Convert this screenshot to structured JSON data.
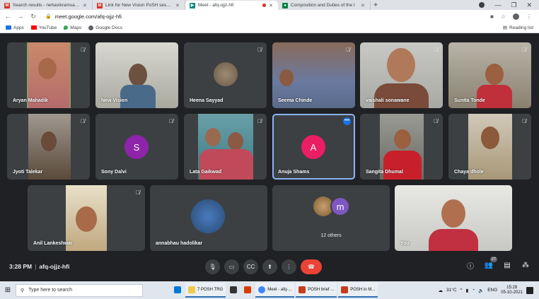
{
  "browser": {
    "tabs": [
      {
        "label": "Search results - nehavikramsathe",
        "favicon": "gmail-icon",
        "color": "#d93025",
        "active": false
      },
      {
        "label": "Link for New Vision PoSH session",
        "favicon": "gmail-icon",
        "color": "#d93025",
        "active": false
      },
      {
        "label": "Meet - afq-ojjz-hfi",
        "favicon": "meet-icon",
        "color": "#00897b",
        "active": true
      },
      {
        "label": "Composition and Duties of the I",
        "favicon": "site-icon",
        "color": "#0b8043",
        "active": false
      }
    ],
    "new_tab": "+",
    "url": "meet.google.com/afq-ojjz-hfi",
    "bookmarks": [
      {
        "label": "Apps",
        "icon": "apps-grid-icon",
        "color": "#1a73e8"
      },
      {
        "label": "YouTube",
        "icon": "youtube-icon",
        "color": "#ff0000"
      },
      {
        "label": "Maps",
        "icon": "maps-pin-icon",
        "color": "#34a853"
      },
      {
        "label": "Google Docs",
        "icon": "docs-icon",
        "color": "#5f6368"
      }
    ],
    "reading_list": "Reading list"
  },
  "participants": [
    {
      "name": "Aryan Mahadik",
      "muted": true
    },
    {
      "name": "New Vision",
      "muted": false
    },
    {
      "name": "Heena Sayyad",
      "muted": true
    },
    {
      "name": "Seema Chinde",
      "muted": true
    },
    {
      "name": "vaishali sonawane",
      "muted": true
    },
    {
      "name": "Sunita Tonde",
      "muted": true
    },
    {
      "name": "Jyoti Talekar",
      "muted": true
    },
    {
      "name": "Sony Dalvi",
      "muted": true,
      "initial": "S",
      "avatar_color": "#8e24aa"
    },
    {
      "name": "Lata Gaikwad",
      "muted": true
    },
    {
      "name": "Anuja Shams",
      "muted": false,
      "initial": "A",
      "avatar_color": "#e91e63",
      "more": "•••"
    },
    {
      "name": "Sangita Dhumal",
      "muted": true
    },
    {
      "name": "Chaya dhole",
      "muted": true
    },
    {
      "name": "Anil Lankeshwar",
      "muted": true
    },
    {
      "name": "annabhau hadolikar",
      "muted": false
    },
    {
      "name": "You",
      "muted": false
    }
  ],
  "others": {
    "label": "12 others",
    "initial": "m",
    "avatar_color": "#7e57c2"
  },
  "meeting": {
    "time": "3:28 PM",
    "code": "afq-ojjz-hfi",
    "participant_count": "27"
  },
  "taskbar": {
    "search_placeholder": "Type here to search",
    "apps": [
      {
        "label": "",
        "icon": "mail-icon",
        "color": "#0078d4",
        "open": false
      },
      {
        "label": "7 POSH TRG",
        "icon": "folder-icon",
        "color": "#f2c94c",
        "open": true
      },
      {
        "label": "",
        "icon": "store-icon",
        "color": "#333333",
        "open": false
      },
      {
        "label": "",
        "icon": "office-icon",
        "color": "#d83b01",
        "open": false
      },
      {
        "label": "Meet - afq-...",
        "icon": "chrome-icon",
        "color": "#4285f4",
        "open": true
      },
      {
        "label": "POSH brief ...",
        "icon": "powerpoint-icon",
        "color": "#c43e1c",
        "open": true
      },
      {
        "label": "POSH in M...",
        "icon": "powerpoint-icon",
        "color": "#c43e1c",
        "open": true
      }
    ],
    "weather": "31°C",
    "lang": "ENG",
    "time": "15:28",
    "date": "05-10-2021"
  }
}
